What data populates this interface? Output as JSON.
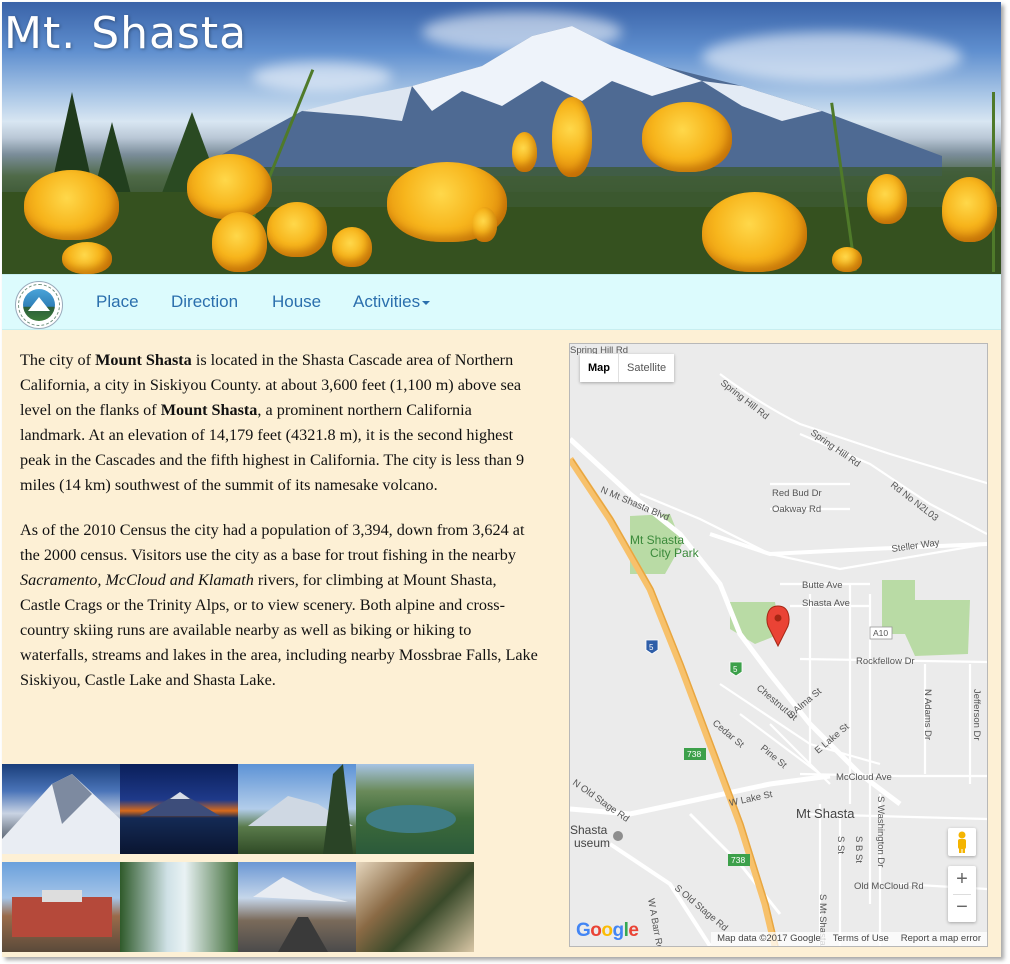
{
  "banner": {
    "title": "Mt. Shasta"
  },
  "nav": {
    "items": [
      {
        "label": "Place"
      },
      {
        "label": "Direction"
      },
      {
        "label": "House"
      },
      {
        "label": "Activities"
      }
    ]
  },
  "content": {
    "p1_parts": [
      "The city of ",
      "Mount Shasta",
      " is located in the Shasta Cascade area of Northern California, a city in Siskiyou County. at about 3,600 feet (1,100 m) above sea level on the flanks of ",
      "Mount Shasta",
      ", a prominent northern California landmark. At an elevation of 14,179 feet (4321.8 m), it is the second highest peak in the Cascades and the fifth highest in California. The city is less than 9 miles (14 km) southwest of the summit of its namesake volcano."
    ],
    "p2_parts": [
      "As of the 2010 Census the city had a population of 3,394, down from 3,624 at the 2000 census. Visitors use the city as a base for trout fishing in the nearby ",
      "Sacramento, McCloud and Klamath",
      " rivers, for climbing at Mount Shasta, Castle Crags or the Trinity Alps, or to view scenery. Both alpine and cross-country skiing runs are available nearby as well as biking or hiking to waterfalls, streams and lakes in the area, including nearby Mossbrae Falls, Lake Siskiyou, Castle Lake and Shasta Lake."
    ]
  },
  "map": {
    "type_map": "Map",
    "type_satellite": "Satellite",
    "zoom_in": "+",
    "zoom_out": "−",
    "google": "Google",
    "footer": {
      "data": "Map data ©2017 Google",
      "terms": "Terms of Use",
      "report": "Report a map error"
    },
    "labels": {
      "spring_hill_rd_top": "Spring Hill Rd",
      "spring_hill_rd": "Spring Hill Rd",
      "spring_hill_rd2": "Spring Hill Rd",
      "red_bud_dr": "Red Bud Dr",
      "oakway_rd": "Oakway Rd",
      "rd_no": "Rd No N2L03",
      "n_mt_shasta_blvd": "N Mt Shasta Blvd",
      "city_park_1": "Mt Shasta",
      "city_park_2": "City Park",
      "steller_way": "Steller Way",
      "butte_ave": "Butte Ave",
      "shasta_ave": "Shasta Ave",
      "a10": "A10",
      "i5": "5",
      "r5": "5",
      "rockfellow_dr": "Rockfellow Dr",
      "chestnut_st": "Chestnut St",
      "e_alma_st": "E Alma St",
      "n_adams_dr": "N Adams Dr",
      "jefferson_dr": "Jefferson Dr",
      "cedar_st": "Cedar St",
      "pine_st": "Pine St",
      "e_lake_st": "E Lake St",
      "r738_1": "738",
      "r738_2": "738",
      "mccloud_ave": "McCloud Ave",
      "w_lake_st": "W Lake St",
      "n_old_stage_rd": "N Old Stage Rd",
      "mt_shasta": "Mt Shasta",
      "s_washington_dr": "S Washington Dr",
      "s_st": "S St",
      "s_b_st": "S B St",
      "shasta_museum_1": "Shasta",
      "shasta_museum_2": "useum",
      "old_mccloud_rd": "Old McCloud Rd",
      "s_old_stage_rd": "S Old Stage Rd",
      "w_a_barr_rd": "W A Barr Rd",
      "s_mt_shasta_ave": "S Mt Shasta Ave"
    }
  }
}
